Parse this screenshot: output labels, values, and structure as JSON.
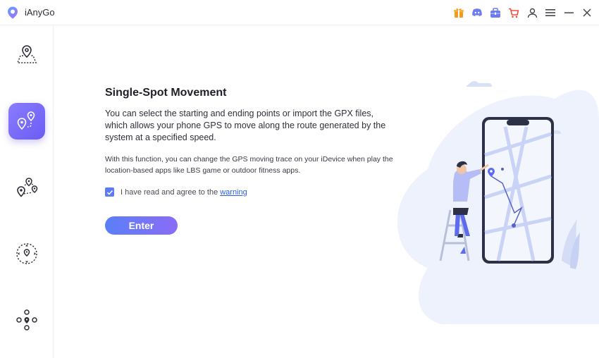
{
  "app": {
    "title": "iAnyGo"
  },
  "titlebar": {
    "icons": [
      "gift-icon",
      "discord-icon",
      "toolbox-icon",
      "cart-icon",
      "user-icon",
      "menu-icon",
      "minimize-icon",
      "close-icon"
    ]
  },
  "sidebar": {
    "items": [
      {
        "name": "change-location",
        "icon": "map-pin-area-icon",
        "active": false
      },
      {
        "name": "single-spot-movement",
        "icon": "two-pins-route-icon",
        "active": true
      },
      {
        "name": "multi-spot-movement",
        "icon": "multi-pin-route-icon",
        "active": false
      },
      {
        "name": "joystick-movement",
        "icon": "joystick-pin-icon",
        "active": false
      },
      {
        "name": "game-mode",
        "icon": "dpad-pin-icon",
        "active": false
      }
    ]
  },
  "main": {
    "heading": "Single-Spot Movement",
    "description": "You can select the starting and ending points or import the GPX files, which allows your phone GPS to move along the route generated by the system at a specified speed.",
    "note": "With this function, you can change the GPS moving trace on your iDevice when play the location-based apps like LBS game or outdoor fitness apps.",
    "agree_text": "I have read and agree to the",
    "warning_link": "warning",
    "agree_checked": true,
    "enter_label": "Enter"
  },
  "colors": {
    "accent": "#6b5cf2",
    "gradient_start": "#5a7ff7",
    "gradient_end": "#8b6cf6",
    "link": "#2f5fe0",
    "gift": "#f39a1e",
    "discord": "#6c7cf0",
    "toolbox": "#6c7cf0",
    "cart": "#ee4d3c"
  }
}
